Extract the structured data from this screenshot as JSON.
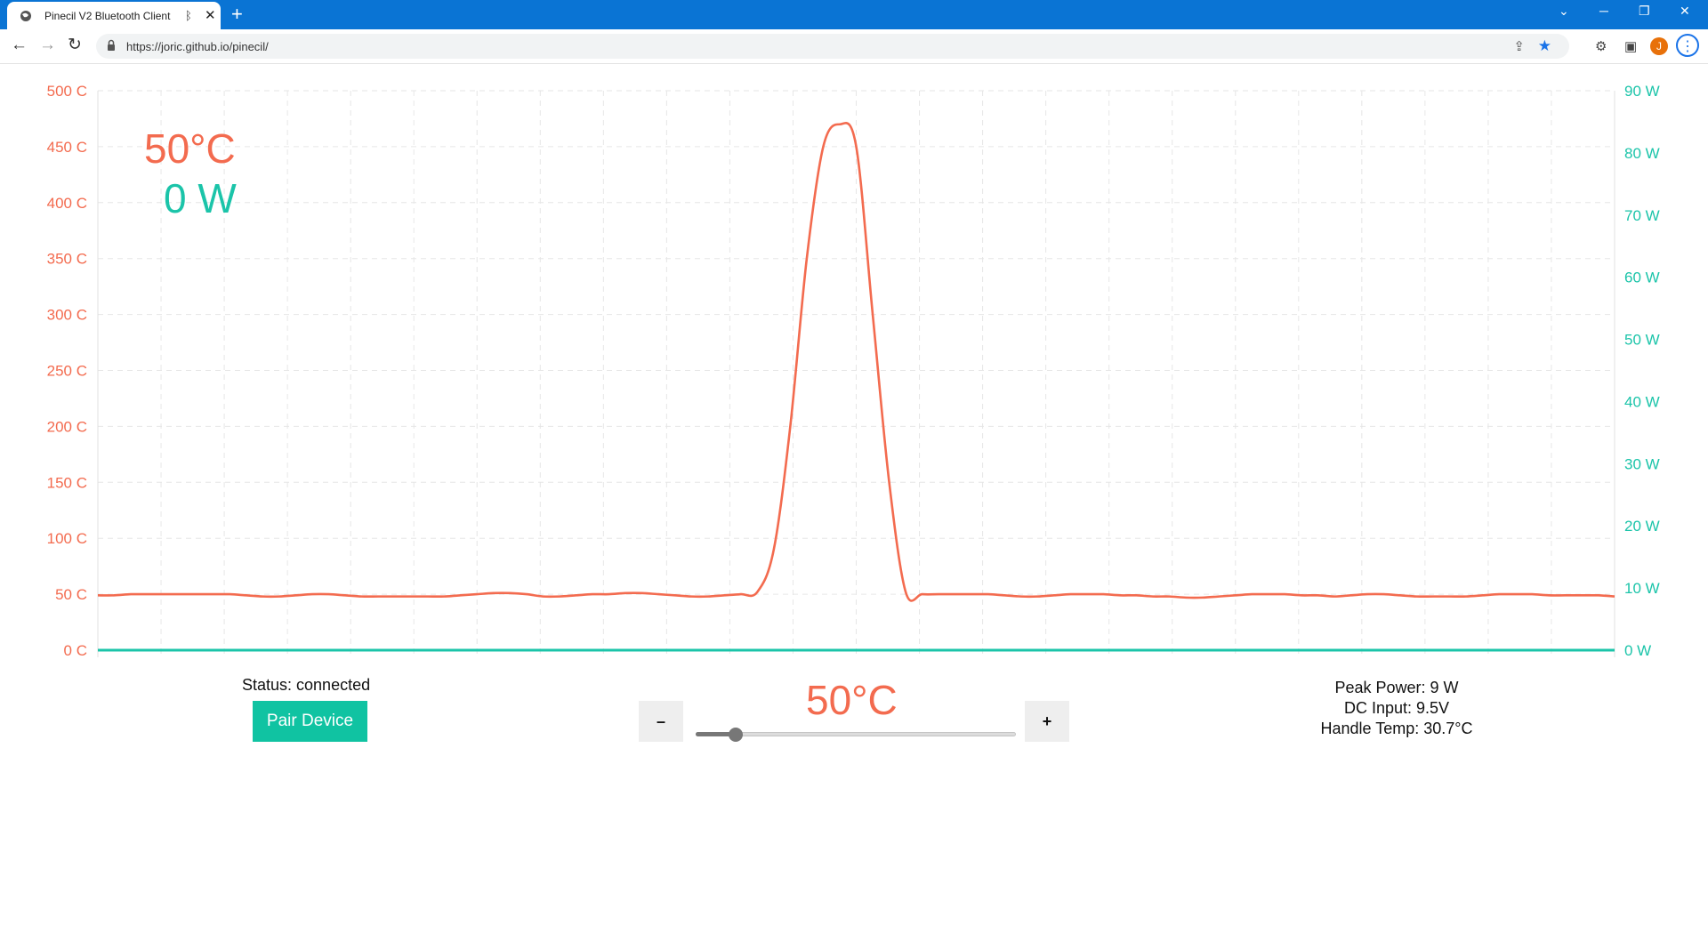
{
  "browser": {
    "tab_title": "Pinecil V2 Bluetooth Client",
    "url": "https://joric.github.io/pinecil/",
    "avatar_initial": "J"
  },
  "readout": {
    "temperature": "50°C",
    "power": "0 W"
  },
  "status": {
    "text": "Status: connected",
    "pair_button": "Pair Device"
  },
  "setpoint": {
    "label": "50°C",
    "minus": "–",
    "plus": "+",
    "slider_fraction": 0.125
  },
  "stats": {
    "peak_power": "Peak Power: 9 W",
    "dc_input": "DC Input: 9.5V",
    "handle_temp": "Handle Temp: 30.7°C"
  },
  "colors": {
    "temperature": "#f36b4f",
    "power": "#1bc4a9",
    "accent_button": "#10c3a2"
  },
  "chart_data": {
    "type": "line",
    "title": "",
    "grid": true,
    "y_left": {
      "min": 0,
      "max": 500,
      "ticks": [
        "500 C",
        "450 C",
        "400 C",
        "350 C",
        "300 C",
        "250 C",
        "200 C",
        "150 C",
        "100 C",
        "50 C",
        "0 C"
      ]
    },
    "y_right": {
      "min": 0,
      "max": 90,
      "ticks": [
        "90 W",
        "80 W",
        "70 W",
        "60 W",
        "50 W",
        "40 W",
        "30 W",
        "20 W",
        "10 W",
        "0 W"
      ]
    },
    "x": [
      0,
      1,
      2,
      3,
      4,
      5,
      6,
      7,
      8,
      9,
      10,
      11,
      12,
      13,
      14,
      15,
      16,
      17,
      18,
      19,
      20,
      21,
      22,
      23,
      24,
      25,
      26,
      27,
      28,
      29,
      30,
      31,
      32,
      33,
      34,
      35,
      36,
      37,
      38,
      39,
      40,
      41,
      42,
      43,
      44,
      45,
      46,
      47,
      48,
      49,
      50,
      51,
      52,
      53,
      54,
      55,
      56,
      57,
      58,
      59,
      60,
      61,
      62,
      63,
      64,
      65,
      66,
      67,
      68,
      69,
      70,
      71,
      72,
      73,
      74,
      75,
      76,
      77,
      78,
      79,
      80,
      81,
      82,
      83,
      84,
      85,
      86,
      87,
      88,
      89,
      90,
      91,
      92
    ],
    "series": [
      {
        "axis": "left",
        "color": "#f36b4f",
        "values": [
          49,
          49,
          50,
          50,
          50,
          50,
          50,
          50,
          50,
          49,
          48,
          48,
          49,
          50,
          50,
          49,
          48,
          48,
          48,
          48,
          48,
          48,
          49,
          50,
          51,
          51,
          50,
          48,
          48,
          49,
          50,
          50,
          51,
          51,
          50,
          49,
          48,
          48,
          49,
          50,
          52,
          90,
          200,
          350,
          450,
          470,
          450,
          300,
          150,
          52,
          50,
          50,
          50,
          50,
          50,
          49,
          48,
          48,
          49,
          50,
          50,
          50,
          49,
          49,
          48,
          48,
          47,
          47,
          48,
          49,
          50,
          50,
          50,
          49,
          49,
          48,
          49,
          50,
          50,
          49,
          48,
          48,
          48,
          48,
          49,
          50,
          50,
          50,
          49,
          49,
          49,
          49,
          48
        ]
      },
      {
        "axis": "right",
        "color": "#1bc4a9",
        "values": [
          0,
          0,
          0,
          0,
          0,
          0,
          0,
          0,
          0,
          0,
          0,
          0,
          0,
          0,
          0,
          0,
          0,
          0,
          0,
          0,
          0,
          0,
          0,
          0,
          0,
          0,
          0,
          0,
          0,
          0,
          0,
          0,
          0,
          0,
          0,
          0,
          0,
          0,
          0,
          0,
          0,
          0,
          0,
          0,
          0,
          0,
          0,
          0,
          0,
          0,
          0,
          0,
          0,
          0,
          0,
          0,
          0,
          0,
          0,
          0,
          0,
          0,
          0,
          0,
          0,
          0,
          0,
          0,
          0,
          0,
          0,
          0,
          0,
          0,
          0,
          0,
          0,
          0,
          0,
          0,
          0,
          0,
          0,
          0,
          0,
          0,
          0,
          0,
          0,
          0,
          0,
          0,
          0
        ]
      }
    ]
  }
}
